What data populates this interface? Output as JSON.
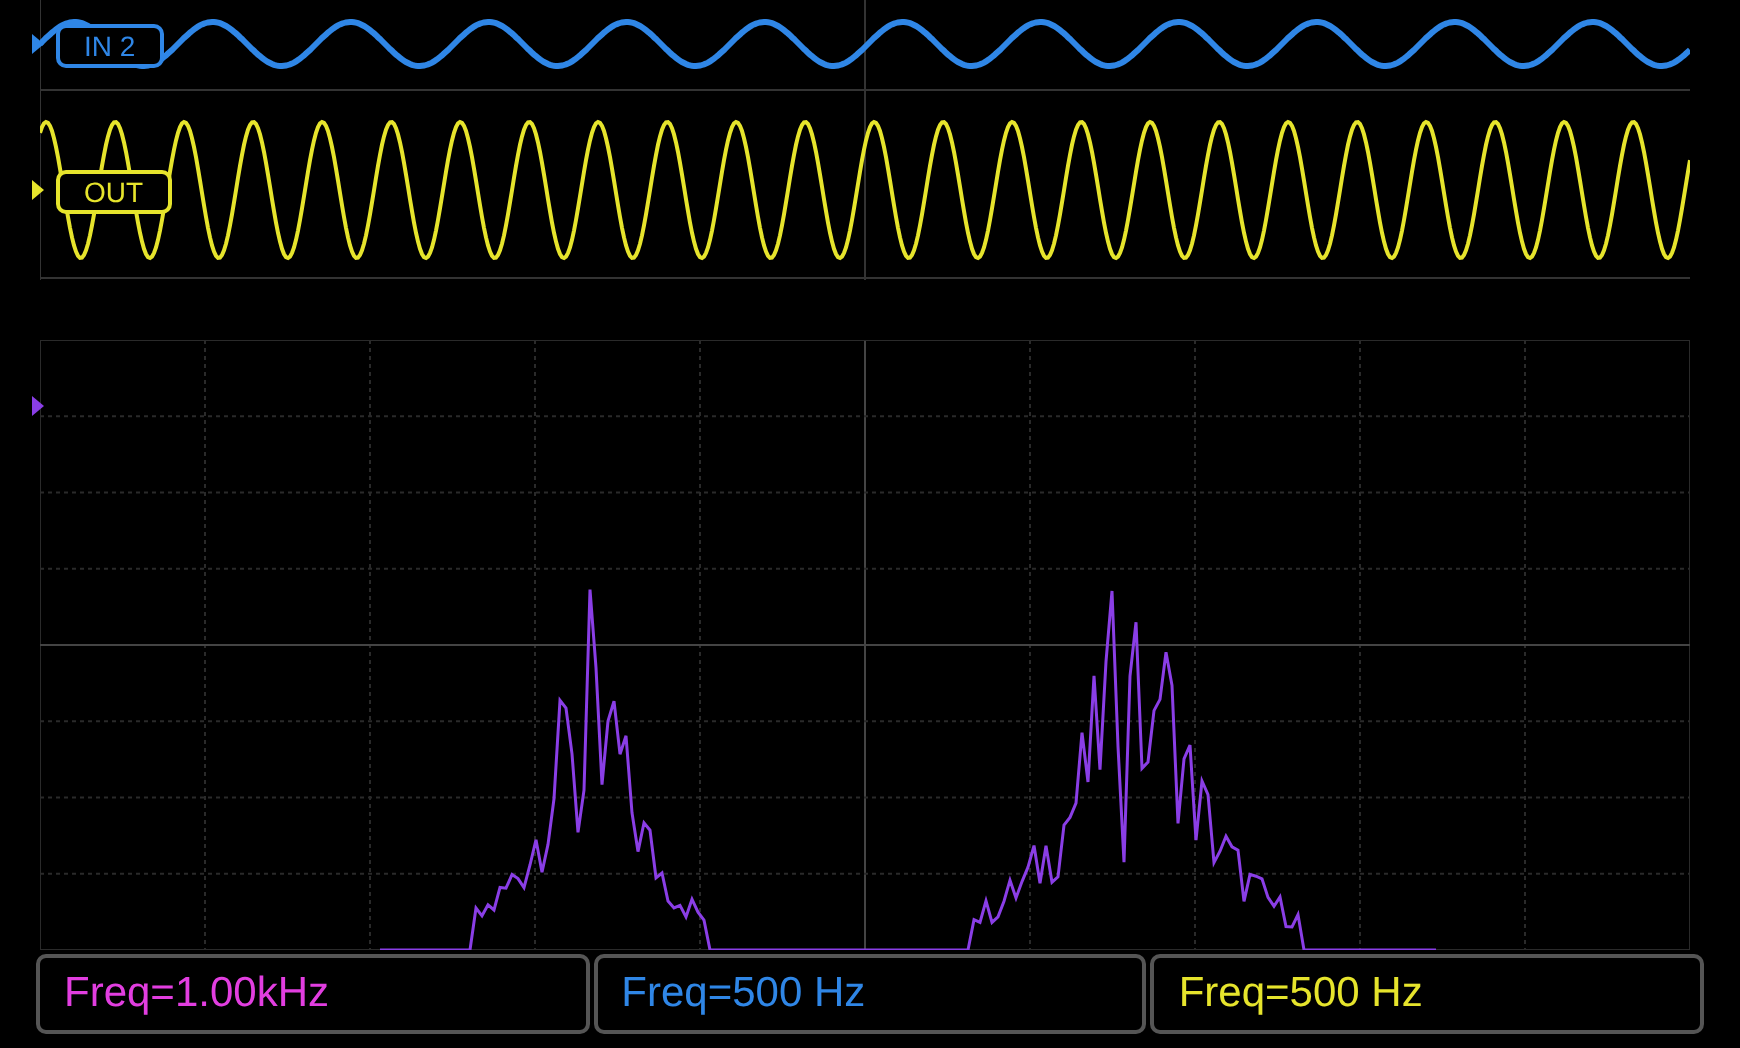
{
  "channels": [
    {
      "label": "IN 2",
      "color": "#2f86e6"
    },
    {
      "label": "OUT",
      "color": "#e6e42c"
    }
  ],
  "measurements": [
    {
      "text": "Freq=1.00kHz",
      "color": "#e23ee0"
    },
    {
      "text": "Freq=500 Hz",
      "color": "#2f86e6"
    },
    {
      "text": "Freq=500 Hz",
      "color": "#e6e42c"
    }
  ]
}
